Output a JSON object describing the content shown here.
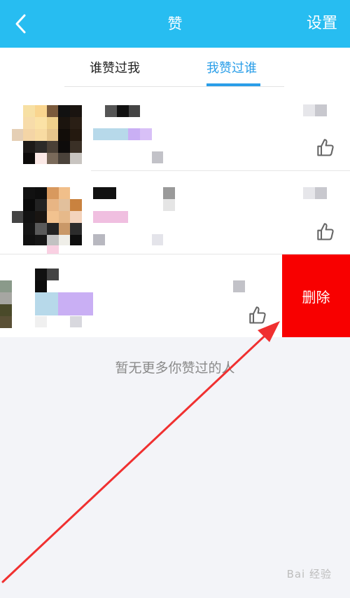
{
  "header": {
    "title": "赞",
    "settings_label": "设置",
    "back_icon": "chevron-left-icon"
  },
  "tabs": [
    {
      "label": "谁赞过我",
      "active": false
    },
    {
      "label": "我赞过谁",
      "active": true
    }
  ],
  "list": {
    "rows": [
      {
        "id": "row-1",
        "like_icon": "thumbs-up-icon"
      },
      {
        "id": "row-2",
        "like_icon": "thumbs-up-icon"
      },
      {
        "id": "row-3",
        "like_icon": "thumbs-up-icon",
        "swiped": true
      }
    ],
    "delete_label": "删除"
  },
  "empty_text": "暂无更多你赞过的人",
  "watermark": "Bai 经验",
  "colors": {
    "header": "#27bdf1",
    "active_tab": "#2a9ee8",
    "delete": "#f80000",
    "annotation_arrow": "#f03030"
  }
}
